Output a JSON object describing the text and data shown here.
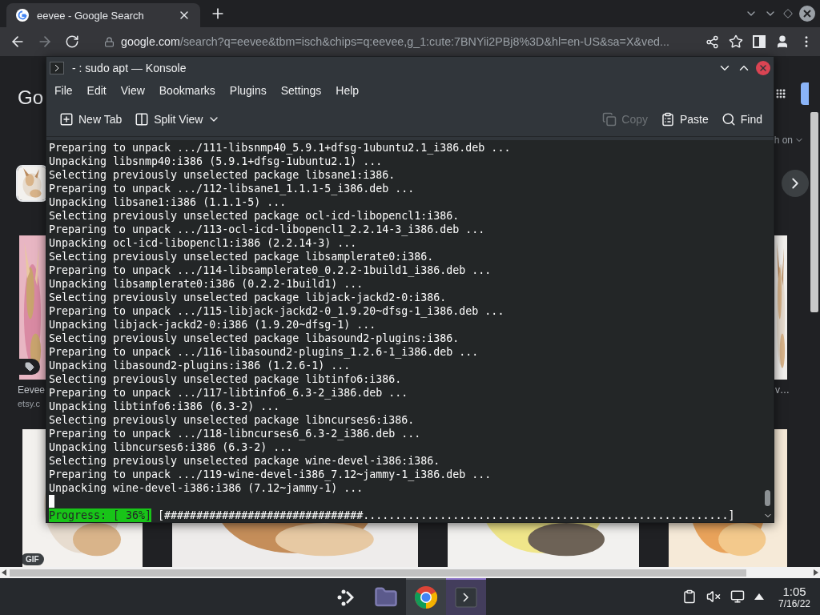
{
  "browser": {
    "tabs": [
      {
        "title": "eevee - Google Search",
        "selected": true
      }
    ],
    "nav": [
      {
        "kind": "back",
        "disabled": false
      },
      {
        "kind": "forward",
        "disabled": true
      },
      {
        "kind": "reload",
        "disabled": false
      }
    ],
    "address": {
      "host": "google.com",
      "path": "/search?q=eevee&tbm=isch&chips=q:eevee,g_1:cute:7BNYii2PBj8%3D&hl=en-US&sa=X&ved..."
    }
  },
  "page": {
    "logo": "Go",
    "filter_label": "h on",
    "left_result": {
      "title": "Eevee",
      "source": "etsy.c"
    },
    "right_result": {
      "title": "v…"
    },
    "badge": "GIF"
  },
  "konsole": {
    "title": "- : sudo apt — Konsole",
    "menu": [
      "File",
      "Edit",
      "View",
      "Bookmarks",
      "Plugins",
      "Settings",
      "Help"
    ],
    "toolbar_left": [
      {
        "kind": "new-tab",
        "label": "New Tab",
        "disabled": false
      },
      {
        "kind": "split-view",
        "label": "Split View",
        "disabled": false
      }
    ],
    "toolbar_right": [
      {
        "kind": "copy",
        "label": "Copy",
        "disabled": true
      },
      {
        "kind": "paste",
        "label": "Paste",
        "disabled": false
      },
      {
        "kind": "find",
        "label": "Find",
        "disabled": false
      }
    ],
    "lines": [
      "Preparing to unpack .../111-libsnmp40_5.9.1+dfsg-1ubuntu2.1_i386.deb ...",
      "Unpacking libsnmp40:i386 (5.9.1+dfsg-1ubuntu2.1) ...",
      "Selecting previously unselected package libsane1:i386.",
      "Preparing to unpack .../112-libsane1_1.1.1-5_i386.deb ...",
      "Unpacking libsane1:i386 (1.1.1-5) ...",
      "Selecting previously unselected package ocl-icd-libopencl1:i386.",
      "Preparing to unpack .../113-ocl-icd-libopencl1_2.2.14-3_i386.deb ...",
      "Unpacking ocl-icd-libopencl1:i386 (2.2.14-3) ...",
      "Selecting previously unselected package libsamplerate0:i386.",
      "Preparing to unpack .../114-libsamplerate0_0.2.2-1build1_i386.deb ...",
      "Unpacking libsamplerate0:i386 (0.2.2-1build1) ...",
      "Selecting previously unselected package libjack-jackd2-0:i386.",
      "Preparing to unpack .../115-libjack-jackd2-0_1.9.20~dfsg-1_i386.deb ...",
      "Unpacking libjack-jackd2-0:i386 (1.9.20~dfsg-1) ...",
      "Selecting previously unselected package libasound2-plugins:i386.",
      "Preparing to unpack .../116-libasound2-plugins_1.2.6-1_i386.deb ...",
      "Unpacking libasound2-plugins:i386 (1.2.6-1) ...",
      "Selecting previously unselected package libtinfo6:i386.",
      "Preparing to unpack .../117-libtinfo6_6.3-2_i386.deb ...",
      "Unpacking libtinfo6:i386 (6.3-2) ...",
      "Selecting previously unselected package libncurses6:i386.",
      "Preparing to unpack .../118-libncurses6_6.3-2_i386.deb ...",
      "Unpacking libncurses6:i386 (6.3-2) ...",
      "Selecting previously unselected package wine-devel-i386:i386.",
      "Preparing to unpack .../119-wine-devel-i386_7.12~jammy-1_i386.deb ...",
      "Unpacking wine-devel-i386:i386 (7.12~jammy-1) ..."
    ],
    "progress": {
      "label": "Progress: [ 36%]",
      "bar": "[###############################.........................................................]"
    }
  },
  "taskbar": {
    "apps": [
      {
        "kind": "launcher",
        "open": false,
        "focused": false
      },
      {
        "kind": "files",
        "open": false,
        "focused": false
      },
      {
        "kind": "browser",
        "open": true,
        "focused": false
      },
      {
        "kind": "terminal",
        "open": true,
        "focused": true
      }
    ],
    "clock": {
      "time": "1:05",
      "date": "7/16/22"
    }
  }
}
